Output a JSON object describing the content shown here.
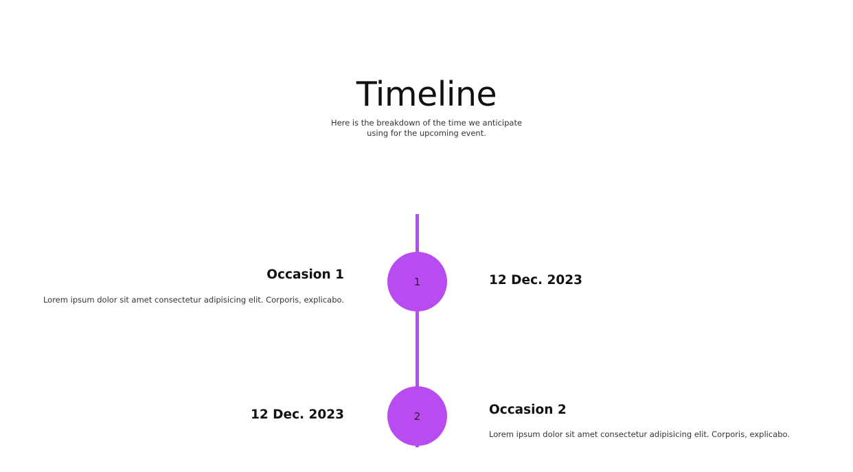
{
  "header": {
    "title": "Timeline",
    "subtitle": "Here is the breakdown of the time we anticipate using for the upcoming event."
  },
  "colors": {
    "accent": "#b94cf0",
    "text": "#111111"
  },
  "items": [
    {
      "number": "1",
      "title": "Occasion 1",
      "description": "Lorem ipsum dolor sit amet consectetur adipisicing elit. Corporis, explicabo.",
      "date": "12 Dec. 2023"
    },
    {
      "number": "2",
      "title": "Occasion 2",
      "description": "Lorem ipsum dolor sit amet consectetur adipisicing elit. Corporis, explicabo.",
      "date": "12 Dec. 2023"
    }
  ]
}
